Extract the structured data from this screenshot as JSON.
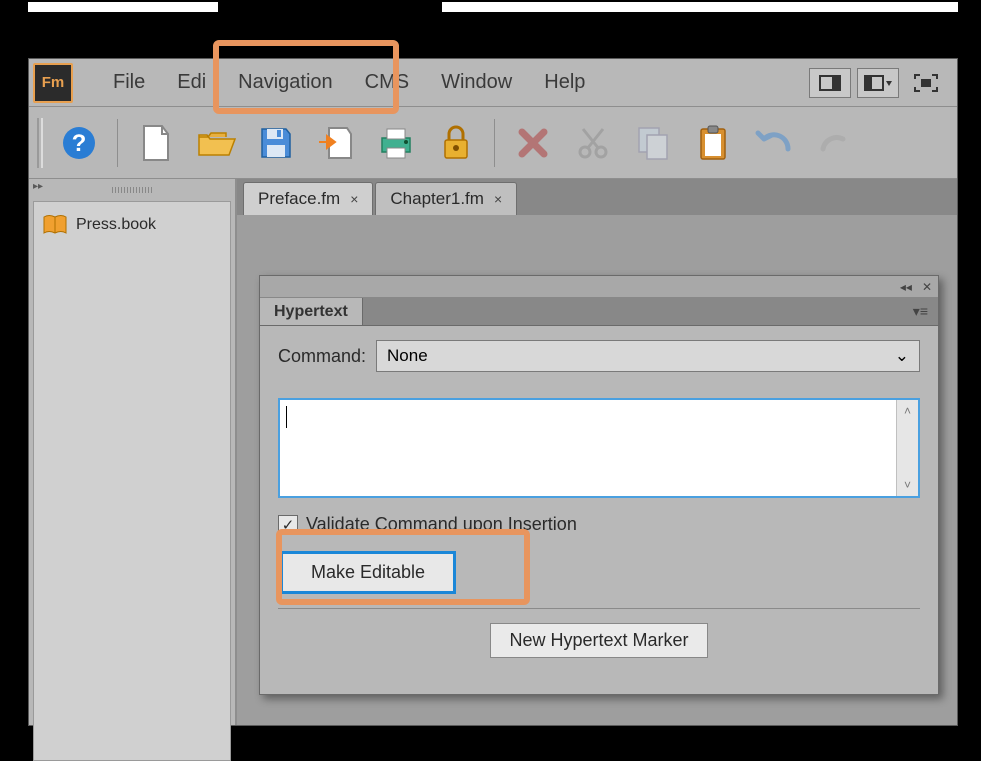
{
  "app": {
    "logo_text": "Fm"
  },
  "menu": {
    "file": "File",
    "edit": "Edi",
    "navigation": "Navigation",
    "cms": "CMS",
    "window": "Window",
    "help": "Help"
  },
  "sidebar": {
    "expand_glyph": "▸▸",
    "book_name": "Press.book"
  },
  "tabs": [
    {
      "label": "Preface.fm",
      "close": "×",
      "active": true
    },
    {
      "label": "Chapter1.fm",
      "close": "×",
      "active": false
    }
  ],
  "panel": {
    "title": "Hypertext",
    "collapse_glyph": "◂◂",
    "close_glyph": "✕",
    "menu_glyph": "▾≡",
    "command_label": "Command:",
    "command_value": "None",
    "dropdown_glyph": "⌄",
    "validate_label": "Validate Command upon Insertion",
    "validate_checked": "✓",
    "make_editable_label": "Make Editable",
    "new_marker_label": "New Hypertext Marker",
    "scroll_up": "˄",
    "scroll_down": "˅"
  }
}
